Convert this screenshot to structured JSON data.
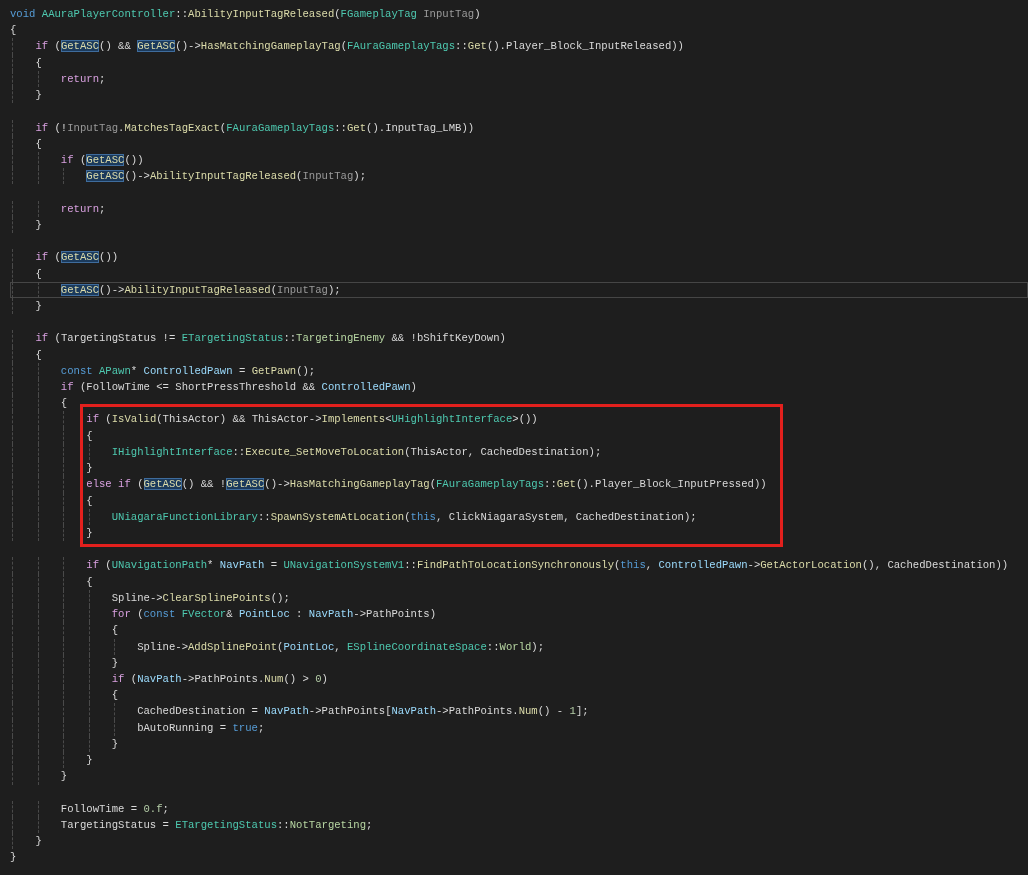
{
  "editor": {
    "lines": [
      {
        "kind": "line",
        "current": false,
        "tokens": [
          {
            "text": "void ",
            "kind": "keyword"
          },
          {
            "text": "AAuraPlayerController",
            "kind": "type"
          },
          {
            "text": "::",
            "kind": "plain"
          },
          {
            "text": "AbilityInputTagReleased",
            "kind": "function"
          },
          {
            "text": "(",
            "kind": "plain"
          },
          {
            "text": "FGameplayTag",
            "kind": "type"
          },
          {
            "text": " InputTag",
            "kind": "param"
          },
          {
            "text": ")",
            "kind": "plain"
          }
        ]
      },
      {
        "kind": "line",
        "current": false,
        "tokens": [
          {
            "text": "{",
            "kind": "plain"
          }
        ]
      },
      {
        "kind": "line",
        "current": false,
        "tokens": [
          {
            "text": "    if",
            "kind": "control"
          },
          {
            "text": " (",
            "kind": "plain"
          },
          {
            "text": "GetASC",
            "kind": "ref"
          },
          {
            "text": "() && ",
            "kind": "plain"
          },
          {
            "text": "GetASC",
            "kind": "ref"
          },
          {
            "text": "()->",
            "kind": "plain"
          },
          {
            "text": "HasMatchingGameplayTag",
            "kind": "function"
          },
          {
            "text": "(",
            "kind": "plain"
          },
          {
            "text": "FAuraGameplayTags",
            "kind": "type"
          },
          {
            "text": "::",
            "kind": "plain"
          },
          {
            "text": "Get",
            "kind": "function"
          },
          {
            "text": "().",
            "kind": "plain"
          },
          {
            "text": "Player_Block_InputReleased",
            "kind": "member"
          },
          {
            "text": "))",
            "kind": "plain"
          }
        ]
      },
      {
        "kind": "line",
        "current": false,
        "tokens": [
          {
            "text": "    {",
            "kind": "plain"
          }
        ]
      },
      {
        "kind": "line",
        "current": false,
        "tokens": [
          {
            "text": "        return",
            "kind": "control"
          },
          {
            "text": ";",
            "kind": "plain"
          }
        ]
      },
      {
        "kind": "line",
        "current": false,
        "tokens": [
          {
            "text": "    }",
            "kind": "plain"
          }
        ]
      },
      {
        "kind": "blank"
      },
      {
        "kind": "line",
        "current": false,
        "tokens": [
          {
            "text": "    if",
            "kind": "control"
          },
          {
            "text": " (!",
            "kind": "plain"
          },
          {
            "text": "InputTag",
            "kind": "param"
          },
          {
            "text": ".",
            "kind": "plain"
          },
          {
            "text": "MatchesTagExact",
            "kind": "function"
          },
          {
            "text": "(",
            "kind": "plain"
          },
          {
            "text": "FAuraGameplayTags",
            "kind": "type"
          },
          {
            "text": "::",
            "kind": "plain"
          },
          {
            "text": "Get",
            "kind": "function"
          },
          {
            "text": "().",
            "kind": "plain"
          },
          {
            "text": "InputTag_LMB",
            "kind": "member"
          },
          {
            "text": "))",
            "kind": "plain"
          }
        ]
      },
      {
        "kind": "line",
        "current": false,
        "tokens": [
          {
            "text": "    {",
            "kind": "plain"
          }
        ]
      },
      {
        "kind": "line",
        "current": false,
        "tokens": [
          {
            "text": "        if",
            "kind": "control"
          },
          {
            "text": " (",
            "kind": "plain"
          },
          {
            "text": "GetASC",
            "kind": "ref"
          },
          {
            "text": "())",
            "kind": "plain"
          }
        ]
      },
      {
        "kind": "line",
        "current": false,
        "tokens": [
          {
            "text": "            GetASC",
            "kind": "ref"
          },
          {
            "text": "()->",
            "kind": "plain"
          },
          {
            "text": "AbilityInputTagReleased",
            "kind": "function"
          },
          {
            "text": "(",
            "kind": "plain"
          },
          {
            "text": "InputTag",
            "kind": "param"
          },
          {
            "text": ");",
            "kind": "plain"
          }
        ]
      },
      {
        "kind": "blank"
      },
      {
        "kind": "line",
        "current": false,
        "tokens": [
          {
            "text": "        return",
            "kind": "control"
          },
          {
            "text": ";",
            "kind": "plain"
          }
        ]
      },
      {
        "kind": "line",
        "current": false,
        "tokens": [
          {
            "text": "    }",
            "kind": "plain"
          }
        ]
      },
      {
        "kind": "blank"
      },
      {
        "kind": "line",
        "current": false,
        "tokens": [
          {
            "text": "    if",
            "kind": "control"
          },
          {
            "text": " (",
            "kind": "plain"
          },
          {
            "text": "GetASC",
            "kind": "ref"
          },
          {
            "text": "())",
            "kind": "plain"
          }
        ]
      },
      {
        "kind": "line",
        "current": false,
        "tokens": [
          {
            "text": "    {",
            "kind": "plain"
          }
        ]
      },
      {
        "kind": "line",
        "current": true,
        "tokens": [
          {
            "text": "        GetASC",
            "kind": "ref"
          },
          {
            "text": "()->",
            "kind": "plain"
          },
          {
            "text": "AbilityInputTagReleased",
            "kind": "function"
          },
          {
            "text": "(",
            "kind": "plain"
          },
          {
            "text": "InputTag",
            "kind": "param"
          },
          {
            "text": ");",
            "kind": "plain"
          }
        ]
      },
      {
        "kind": "line",
        "current": false,
        "tokens": [
          {
            "text": "    }",
            "kind": "plain"
          }
        ]
      },
      {
        "kind": "blank"
      },
      {
        "kind": "line",
        "current": false,
        "tokens": [
          {
            "text": "    if",
            "kind": "control"
          },
          {
            "text": " (",
            "kind": "plain"
          },
          {
            "text": "TargetingStatus",
            "kind": "member"
          },
          {
            "text": " != ",
            "kind": "plain"
          },
          {
            "text": "ETargetingStatus",
            "kind": "type"
          },
          {
            "text": "::",
            "kind": "plain"
          },
          {
            "text": "TargetingEnemy",
            "kind": "enum"
          },
          {
            "text": " && !",
            "kind": "plain"
          },
          {
            "text": "bShiftKeyDown",
            "kind": "member"
          },
          {
            "text": ")",
            "kind": "plain"
          }
        ]
      },
      {
        "kind": "line",
        "current": false,
        "tokens": [
          {
            "text": "    {",
            "kind": "plain"
          }
        ]
      },
      {
        "kind": "line",
        "current": false,
        "tokens": [
          {
            "text": "        const",
            "kind": "keyword"
          },
          {
            "text": " APawn",
            "kind": "type"
          },
          {
            "text": "* ",
            "kind": "plain"
          },
          {
            "text": "ControlledPawn",
            "kind": "local"
          },
          {
            "text": " = ",
            "kind": "plain"
          },
          {
            "text": "GetPawn",
            "kind": "function"
          },
          {
            "text": "();",
            "kind": "plain"
          }
        ]
      },
      {
        "kind": "line",
        "current": false,
        "tokens": [
          {
            "text": "        if",
            "kind": "control"
          },
          {
            "text": " (",
            "kind": "plain"
          },
          {
            "text": "FollowTime",
            "kind": "member"
          },
          {
            "text": " <= ",
            "kind": "plain"
          },
          {
            "text": "ShortPressThreshold",
            "kind": "member"
          },
          {
            "text": " && ",
            "kind": "plain"
          },
          {
            "text": "ControlledPawn",
            "kind": "local"
          },
          {
            "text": ")",
            "kind": "plain"
          }
        ]
      },
      {
        "kind": "line",
        "current": false,
        "tokens": [
          {
            "text": "        {",
            "kind": "plain"
          }
        ]
      },
      {
        "kind": "box",
        "lines": [
          {
            "kind": "line",
            "current": false,
            "tokens": [
              {
                "text": "            if",
                "kind": "control"
              },
              {
                "text": " (",
                "kind": "plain"
              },
              {
                "text": "IsValid",
                "kind": "function"
              },
              {
                "text": "(",
                "kind": "plain"
              },
              {
                "text": "ThisActor",
                "kind": "member"
              },
              {
                "text": ") && ",
                "kind": "plain"
              },
              {
                "text": "ThisActor",
                "kind": "member"
              },
              {
                "text": "->",
                "kind": "plain"
              },
              {
                "text": "Implements",
                "kind": "function"
              },
              {
                "text": "<",
                "kind": "plain"
              },
              {
                "text": "UHighlightInterface",
                "kind": "type"
              },
              {
                "text": ">())",
                "kind": "plain"
              }
            ]
          },
          {
            "kind": "line",
            "current": false,
            "tokens": [
              {
                "text": "            {",
                "kind": "plain"
              }
            ]
          },
          {
            "kind": "line",
            "current": false,
            "tokens": [
              {
                "text": "                IHighlightInterface",
                "kind": "type"
              },
              {
                "text": "::",
                "kind": "plain"
              },
              {
                "text": "Execute_SetMoveToLocation",
                "kind": "function"
              },
              {
                "text": "(",
                "kind": "plain"
              },
              {
                "text": "ThisActor",
                "kind": "member"
              },
              {
                "text": ", ",
                "kind": "plain"
              },
              {
                "text": "CachedDestination",
                "kind": "member"
              },
              {
                "text": ");",
                "kind": "plain"
              }
            ]
          },
          {
            "kind": "line",
            "current": false,
            "tokens": [
              {
                "text": "            }",
                "kind": "plain"
              }
            ]
          },
          {
            "kind": "line",
            "current": false,
            "tokens": [
              {
                "text": "            else if",
                "kind": "control"
              },
              {
                "text": " (",
                "kind": "plain"
              },
              {
                "text": "GetASC",
                "kind": "ref"
              },
              {
                "text": "() && !",
                "kind": "plain"
              },
              {
                "text": "GetASC",
                "kind": "ref"
              },
              {
                "text": "()->",
                "kind": "plain"
              },
              {
                "text": "HasMatchingGameplayTag",
                "kind": "function"
              },
              {
                "text": "(",
                "kind": "plain"
              },
              {
                "text": "FAuraGameplayTags",
                "kind": "type"
              },
              {
                "text": "::",
                "kind": "plain"
              },
              {
                "text": "Get",
                "kind": "function"
              },
              {
                "text": "().",
                "kind": "plain"
              },
              {
                "text": "Player_Block_InputPressed",
                "kind": "member"
              },
              {
                "text": "))",
                "kind": "plain"
              }
            ]
          },
          {
            "kind": "line",
            "current": false,
            "tokens": [
              {
                "text": "            {",
                "kind": "plain"
              }
            ]
          },
          {
            "kind": "line",
            "current": false,
            "tokens": [
              {
                "text": "                UNiagaraFunctionLibrary",
                "kind": "type"
              },
              {
                "text": "::",
                "kind": "plain"
              },
              {
                "text": "SpawnSystemAtLocation",
                "kind": "function"
              },
              {
                "text": "(",
                "kind": "plain"
              },
              {
                "text": "this",
                "kind": "keyword"
              },
              {
                "text": ", ",
                "kind": "plain"
              },
              {
                "text": "ClickNiagaraSystem",
                "kind": "member"
              },
              {
                "text": ", ",
                "kind": "plain"
              },
              {
                "text": "CachedDestination",
                "kind": "member"
              },
              {
                "text": ");",
                "kind": "plain"
              }
            ]
          },
          {
            "kind": "line",
            "current": false,
            "tokens": [
              {
                "text": "            }",
                "kind": "plain"
              }
            ]
          }
        ]
      },
      {
        "kind": "blank"
      },
      {
        "kind": "line",
        "current": false,
        "tokens": [
          {
            "text": "            if",
            "kind": "control"
          },
          {
            "text": " (",
            "kind": "plain"
          },
          {
            "text": "UNavigationPath",
            "kind": "type"
          },
          {
            "text": "* ",
            "kind": "plain"
          },
          {
            "text": "NavPath",
            "kind": "local"
          },
          {
            "text": " = ",
            "kind": "plain"
          },
          {
            "text": "UNavigationSystemV1",
            "kind": "type"
          },
          {
            "text": "::",
            "kind": "plain"
          },
          {
            "text": "FindPathToLocationSynchronously",
            "kind": "function"
          },
          {
            "text": "(",
            "kind": "plain"
          },
          {
            "text": "this",
            "kind": "keyword"
          },
          {
            "text": ", ",
            "kind": "plain"
          },
          {
            "text": "ControlledPawn",
            "kind": "local"
          },
          {
            "text": "->",
            "kind": "plain"
          },
          {
            "text": "GetActorLocation",
            "kind": "function"
          },
          {
            "text": "(), ",
            "kind": "plain"
          },
          {
            "text": "CachedDestination",
            "kind": "member"
          },
          {
            "text": "))",
            "kind": "plain"
          }
        ]
      },
      {
        "kind": "line",
        "current": false,
        "tokens": [
          {
            "text": "            {",
            "kind": "plain"
          }
        ]
      },
      {
        "kind": "line",
        "current": false,
        "tokens": [
          {
            "text": "                Spline",
            "kind": "member"
          },
          {
            "text": "->",
            "kind": "plain"
          },
          {
            "text": "ClearSplinePoints",
            "kind": "function"
          },
          {
            "text": "();",
            "kind": "plain"
          }
        ]
      },
      {
        "kind": "line",
        "current": false,
        "tokens": [
          {
            "text": "                for",
            "kind": "control"
          },
          {
            "text": " (",
            "kind": "plain"
          },
          {
            "text": "const",
            "kind": "keyword"
          },
          {
            "text": " FVector",
            "kind": "type"
          },
          {
            "text": "& ",
            "kind": "plain"
          },
          {
            "text": "PointLoc",
            "kind": "local"
          },
          {
            "text": " : ",
            "kind": "plain"
          },
          {
            "text": "NavPath",
            "kind": "local"
          },
          {
            "text": "->",
            "kind": "plain"
          },
          {
            "text": "PathPoints",
            "kind": "member"
          },
          {
            "text": ")",
            "kind": "plain"
          }
        ]
      },
      {
        "kind": "line",
        "current": false,
        "tokens": [
          {
            "text": "                {",
            "kind": "plain"
          }
        ]
      },
      {
        "kind": "line",
        "current": false,
        "tokens": [
          {
            "text": "                    Spline",
            "kind": "member"
          },
          {
            "text": "->",
            "kind": "plain"
          },
          {
            "text": "AddSplinePoint",
            "kind": "function"
          },
          {
            "text": "(",
            "kind": "plain"
          },
          {
            "text": "PointLoc",
            "kind": "local"
          },
          {
            "text": ", ",
            "kind": "plain"
          },
          {
            "text": "ESplineCoordinateSpace",
            "kind": "type"
          },
          {
            "text": "::",
            "kind": "plain"
          },
          {
            "text": "World",
            "kind": "enum"
          },
          {
            "text": ");",
            "kind": "plain"
          }
        ]
      },
      {
        "kind": "line",
        "current": false,
        "tokens": [
          {
            "text": "                }",
            "kind": "plain"
          }
        ]
      },
      {
        "kind": "line",
        "current": false,
        "tokens": [
          {
            "text": "                if",
            "kind": "control"
          },
          {
            "text": " (",
            "kind": "plain"
          },
          {
            "text": "NavPath",
            "kind": "local"
          },
          {
            "text": "->",
            "kind": "plain"
          },
          {
            "text": "PathPoints",
            "kind": "member"
          },
          {
            "text": ".",
            "kind": "plain"
          },
          {
            "text": "Num",
            "kind": "function"
          },
          {
            "text": "() > ",
            "kind": "plain"
          },
          {
            "text": "0",
            "kind": "number"
          },
          {
            "text": ")",
            "kind": "plain"
          }
        ]
      },
      {
        "kind": "line",
        "current": false,
        "tokens": [
          {
            "text": "                {",
            "kind": "plain"
          }
        ]
      },
      {
        "kind": "line",
        "current": false,
        "tokens": [
          {
            "text": "                    CachedDestination",
            "kind": "member"
          },
          {
            "text": " = ",
            "kind": "plain"
          },
          {
            "text": "NavPath",
            "kind": "local"
          },
          {
            "text": "->",
            "kind": "plain"
          },
          {
            "text": "PathPoints",
            "kind": "member"
          },
          {
            "text": "[",
            "kind": "plain"
          },
          {
            "text": "NavPath",
            "kind": "local"
          },
          {
            "text": "->",
            "kind": "plain"
          },
          {
            "text": "PathPoints",
            "kind": "member"
          },
          {
            "text": ".",
            "kind": "plain"
          },
          {
            "text": "Num",
            "kind": "function"
          },
          {
            "text": "() - ",
            "kind": "plain"
          },
          {
            "text": "1",
            "kind": "number"
          },
          {
            "text": "];",
            "kind": "plain"
          }
        ]
      },
      {
        "kind": "line",
        "current": false,
        "tokens": [
          {
            "text": "                    bAutoRunning",
            "kind": "member"
          },
          {
            "text": " = ",
            "kind": "plain"
          },
          {
            "text": "true",
            "kind": "keyword"
          },
          {
            "text": ";",
            "kind": "plain"
          }
        ]
      },
      {
        "kind": "line",
        "current": false,
        "tokens": [
          {
            "text": "                }",
            "kind": "plain"
          }
        ]
      },
      {
        "kind": "line",
        "current": false,
        "tokens": [
          {
            "text": "            }",
            "kind": "plain"
          }
        ]
      },
      {
        "kind": "line",
        "current": false,
        "tokens": [
          {
            "text": "        }",
            "kind": "plain"
          }
        ]
      },
      {
        "kind": "blank"
      },
      {
        "kind": "line",
        "current": false,
        "tokens": [
          {
            "text": "        FollowTime",
            "kind": "member"
          },
          {
            "text": " = ",
            "kind": "plain"
          },
          {
            "text": "0.f",
            "kind": "number"
          },
          {
            "text": ";",
            "kind": "plain"
          }
        ]
      },
      {
        "kind": "line",
        "current": false,
        "tokens": [
          {
            "text": "        TargetingStatus",
            "kind": "member"
          },
          {
            "text": " = ",
            "kind": "plain"
          },
          {
            "text": "ETargetingStatus",
            "kind": "type"
          },
          {
            "text": "::",
            "kind": "plain"
          },
          {
            "text": "NotTargeting",
            "kind": "enum"
          },
          {
            "text": ";",
            "kind": "plain"
          }
        ]
      },
      {
        "kind": "line",
        "current": false,
        "tokens": [
          {
            "text": "    }",
            "kind": "plain"
          }
        ]
      },
      {
        "kind": "line",
        "current": false,
        "tokens": [
          {
            "text": "}",
            "kind": "plain"
          }
        ]
      }
    ]
  }
}
